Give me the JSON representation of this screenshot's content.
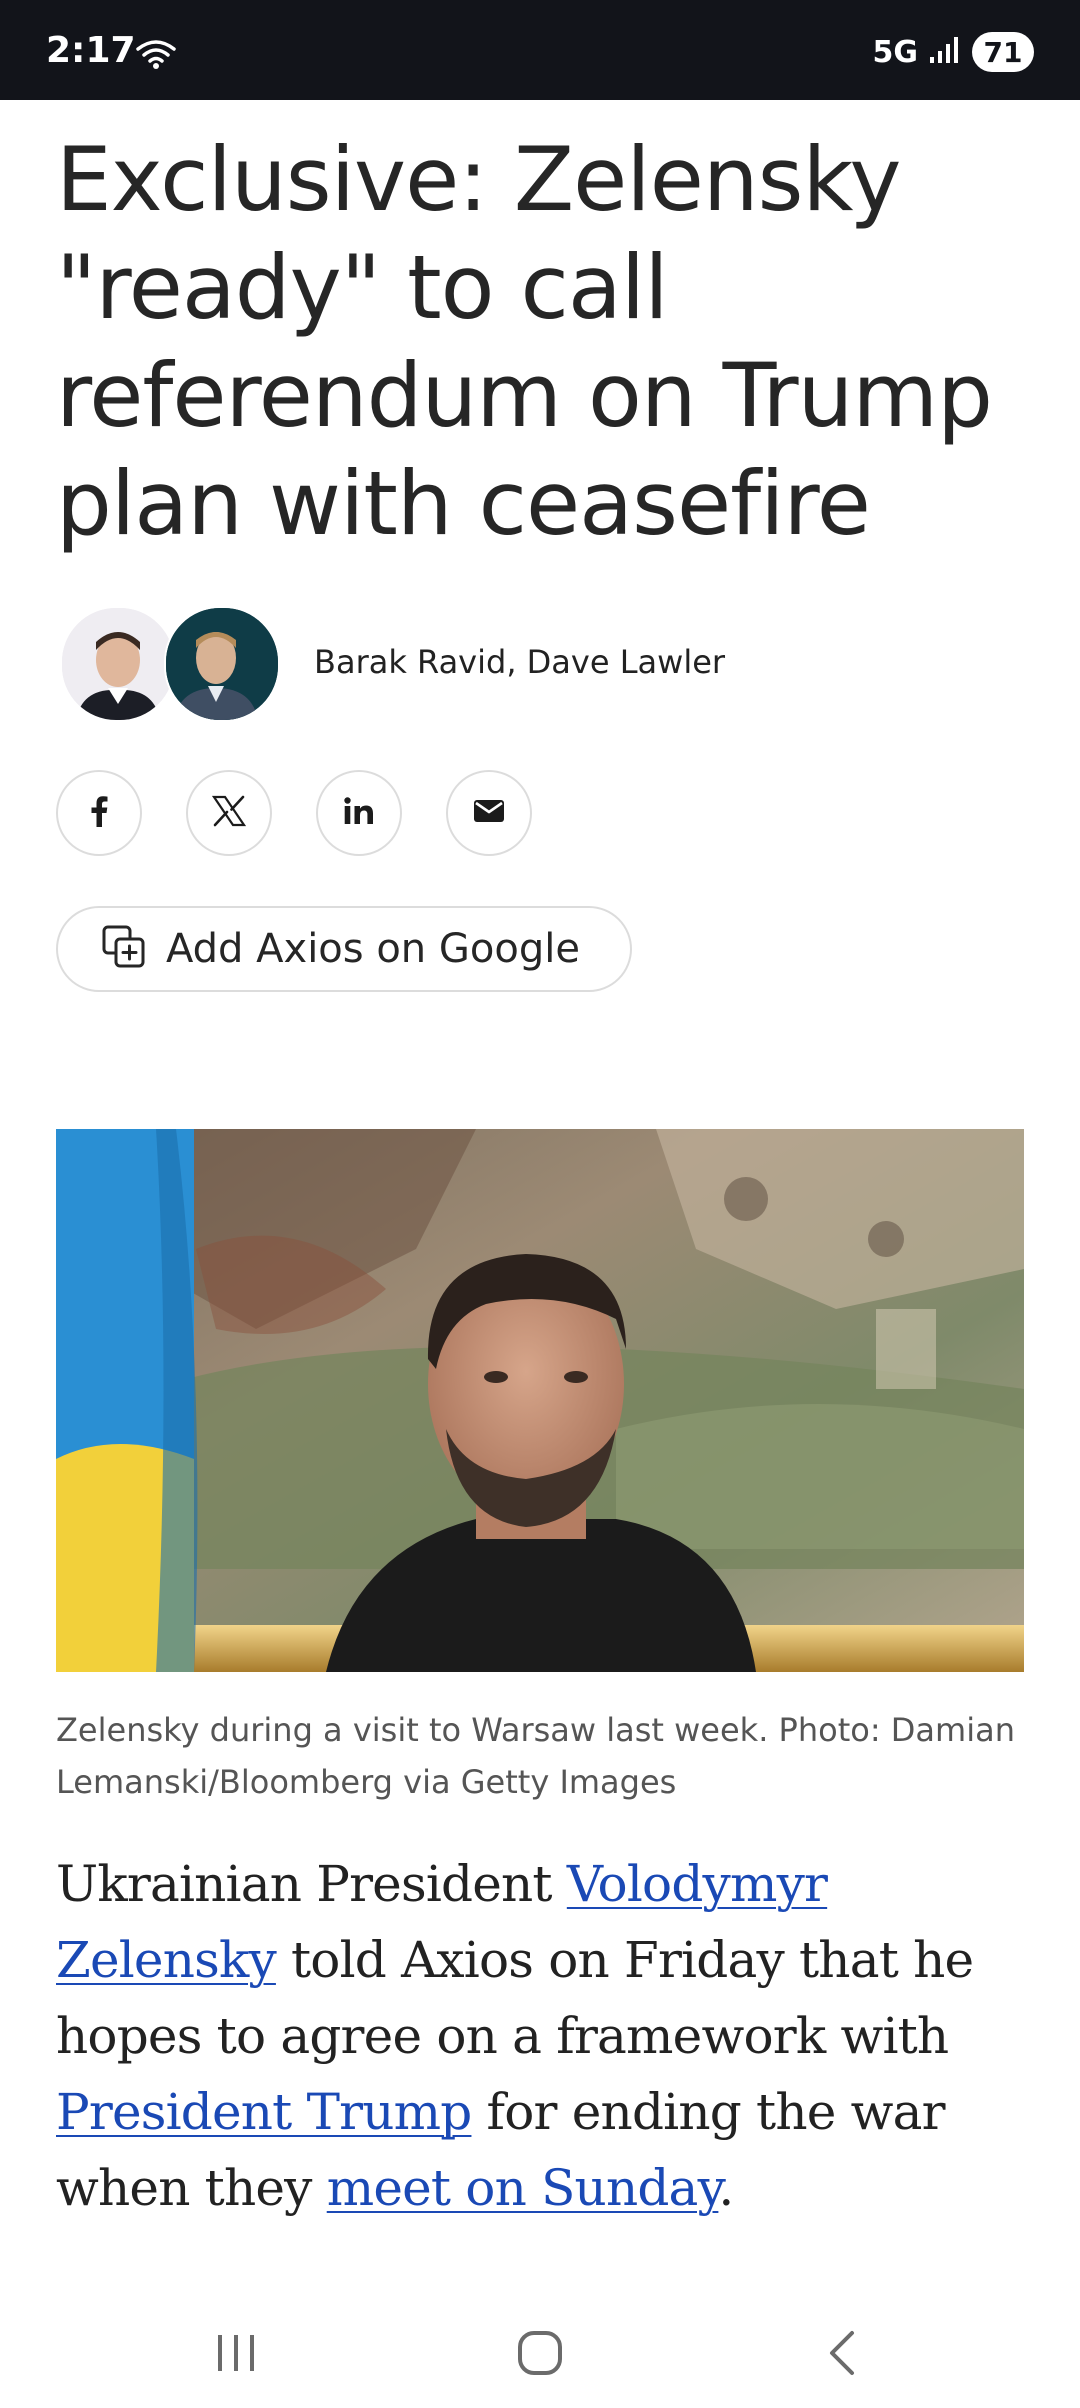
{
  "status_bar": {
    "time": "2:17",
    "network": "5G",
    "battery": "71"
  },
  "article": {
    "headline": "Exclusive: Zelensky \"ready\" to call referendum on Trump plan with ceasefire",
    "authors": "Barak Ravid, Dave Lawler",
    "add_google_label": "Add Axios on Google",
    "caption": "Zelensky during a visit to Warsaw last week. Photo: Damian Lemanski/Bloomberg via Getty Images",
    "body": {
      "t1": "Ukrainian President ",
      "link1": "Volodymyr Zelensky",
      "t2": " told Axios on Friday that he hopes to agree on a framework with ",
      "link2": "President Trump",
      "t3": " for ending the war when they ",
      "link3": "meet on Sunday",
      "t4": "."
    }
  },
  "share_buttons": [
    "facebook-icon",
    "x-icon",
    "linkedin-icon",
    "email-icon"
  ],
  "colors": {
    "status_bar_bg": "#12141a",
    "link": "#1a49b5",
    "headline": "#262626"
  }
}
